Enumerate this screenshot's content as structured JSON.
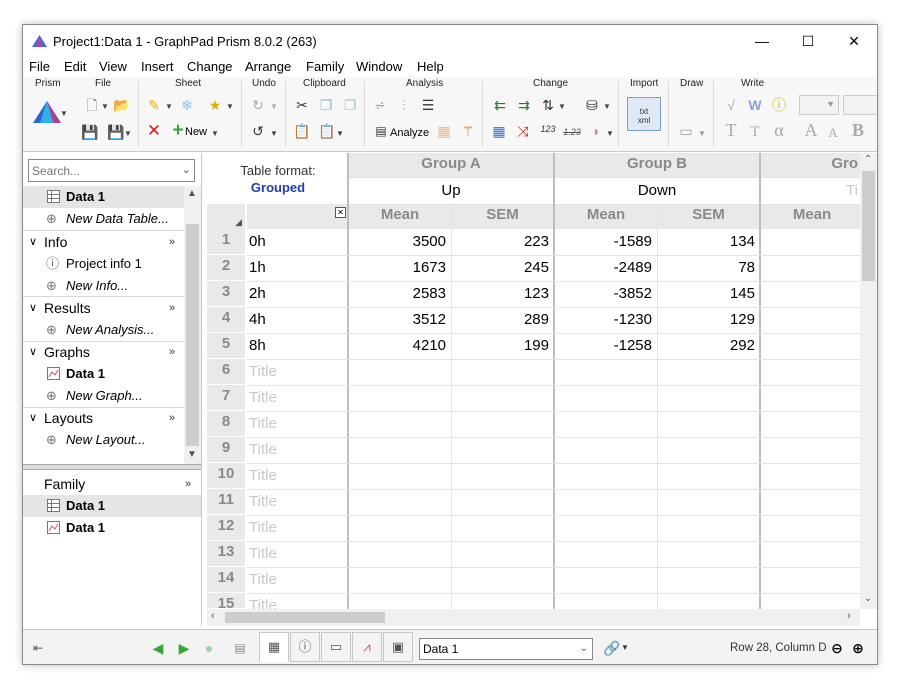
{
  "window": {
    "title": "Project1:Data 1 - GraphPad Prism 8.0.2 (263)",
    "min_glyph": "—",
    "max_glyph": "☐",
    "close_glyph": "✕"
  },
  "menu": [
    "File",
    "Edit",
    "View",
    "Insert",
    "Change",
    "Arrange",
    "Family",
    "Window",
    "Help"
  ],
  "ribbon": {
    "groups": [
      "Prism",
      "File",
      "Sheet",
      "Undo",
      "Clipboard",
      "Analysis",
      "Change",
      "Import",
      "Draw",
      "Write"
    ],
    "new_label": "New",
    "analyze_label": "Analyze",
    "import_icon_text": "txt\nxml",
    "write_letters": {
      "T1": "T",
      "T2": "T",
      "alpha": "α",
      "A1": "A",
      "A2": "A",
      "B": "B"
    },
    "change_numbers": {
      "n1": "123",
      "n2": "1.23"
    }
  },
  "navigator": {
    "search_placeholder": "Search...",
    "sections": [
      {
        "id": "data",
        "items": [
          {
            "label": "Data 1",
            "bold": true,
            "icon": "table-icon"
          },
          {
            "label": "New Data Table...",
            "italic": true,
            "icon": "add-icon"
          }
        ]
      },
      {
        "id": "info",
        "label": "Info",
        "items": [
          {
            "label": "Project info 1",
            "icon": "info-icon"
          },
          {
            "label": "New Info...",
            "italic": true,
            "icon": "add-icon"
          }
        ]
      },
      {
        "id": "results",
        "label": "Results",
        "items": [
          {
            "label": "New Analysis...",
            "italic": true,
            "icon": "add-icon"
          }
        ]
      },
      {
        "id": "graphs",
        "label": "Graphs",
        "items": [
          {
            "label": "Data 1",
            "bold": true,
            "icon": "graph-icon"
          },
          {
            "label": "New Graph...",
            "italic": true,
            "icon": "add-icon"
          }
        ]
      },
      {
        "id": "layouts",
        "label": "Layouts",
        "items": [
          {
            "label": "New Layout...",
            "italic": true,
            "icon": "add-icon"
          }
        ]
      }
    ],
    "family": {
      "label": "Family",
      "items": [
        {
          "label": "Data 1",
          "icon": "table-icon"
        },
        {
          "label": "Data 1",
          "icon": "graph-icon"
        }
      ]
    },
    "more_glyph": "»"
  },
  "sheet": {
    "table_format_label": "Table format:",
    "table_format_value": "Grouped",
    "groups": [
      {
        "header": "Group A",
        "name": "Up",
        "subcols": [
          "Mean",
          "SEM"
        ]
      },
      {
        "header": "Group B",
        "name": "Down",
        "subcols": [
          "Mean",
          "SEM"
        ]
      },
      {
        "header": "Gro",
        "name": "Ti",
        "subcols": [
          "Mean"
        ]
      }
    ],
    "rows": [
      {
        "num": "1",
        "title": "0h",
        "values": [
          "3500",
          "223",
          "-1589",
          "134"
        ]
      },
      {
        "num": "2",
        "title": "1h",
        "values": [
          "1673",
          "245",
          "-2489",
          "78"
        ]
      },
      {
        "num": "3",
        "title": "2h",
        "values": [
          "2583",
          "123",
          "-3852",
          "145"
        ]
      },
      {
        "num": "4",
        "title": "4h",
        "values": [
          "3512",
          "289",
          "-1230",
          "129"
        ]
      },
      {
        "num": "5",
        "title": "8h",
        "values": [
          "4210",
          "199",
          "-1258",
          "292"
        ]
      },
      {
        "num": "6",
        "title": "Title",
        "placeholder": true,
        "values": []
      },
      {
        "num": "7",
        "title": "Title",
        "placeholder": true,
        "values": []
      },
      {
        "num": "8",
        "title": "Title",
        "placeholder": true,
        "values": []
      },
      {
        "num": "9",
        "title": "Title",
        "placeholder": true,
        "values": []
      },
      {
        "num": "10",
        "title": "Title",
        "placeholder": true,
        "values": []
      },
      {
        "num": "11",
        "title": "Title",
        "placeholder": true,
        "values": []
      },
      {
        "num": "12",
        "title": "Title",
        "placeholder": true,
        "values": []
      },
      {
        "num": "13",
        "title": "Title",
        "placeholder": true,
        "values": []
      },
      {
        "num": "14",
        "title": "Title",
        "placeholder": true,
        "values": []
      },
      {
        "num": "15",
        "title": "Title",
        "placeholder": true,
        "values": []
      }
    ]
  },
  "bottom": {
    "sheet_selector_value": "Data 1",
    "status": "Row 28, Column D"
  },
  "colors": {
    "accent_blue": "#1f3fb0",
    "green_arrow": "#3aa53a",
    "red_x": "#d11f1f",
    "header_gray": "#e9e9e9",
    "header_text": "#8a8a8a"
  }
}
